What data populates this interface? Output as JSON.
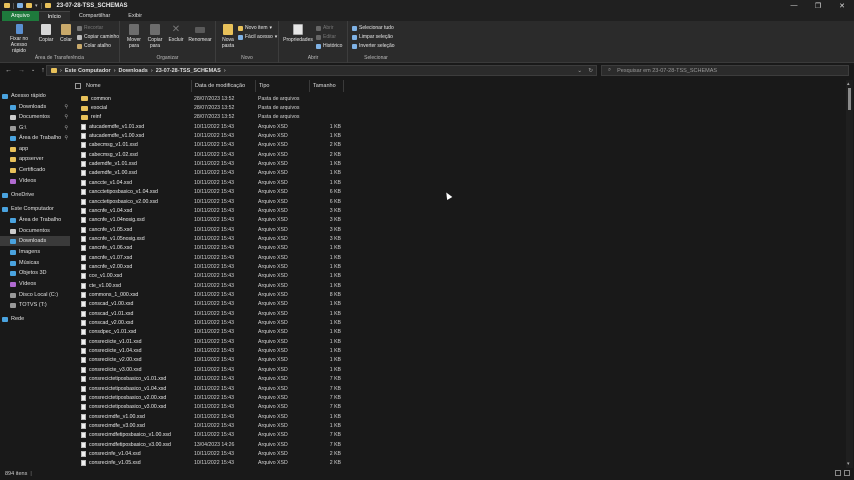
{
  "window": {
    "title": "23-07-28-TSS_SCHEMAS",
    "controls": [
      "—",
      "❐",
      "✕"
    ]
  },
  "tabs": [
    "Arquivo",
    "Início",
    "Compartilhar",
    "Exibir"
  ],
  "ribbon": {
    "groups": {
      "clipboard": "Área de Transferência",
      "organize": "Organizar",
      "new": "Novo",
      "open": "Abrir",
      "select": "Selecionar"
    },
    "buttons": {
      "pin": "Fixar no Acesso rápido",
      "copy": "Copiar",
      "paste": "Colar",
      "cut": "Recortar",
      "copy_path": "Copiar caminho",
      "paste_shortcut": "Colar atalho",
      "move_to": "Mover para",
      "copy_to": "Copiar para",
      "delete": "Excluir",
      "rename": "Renomear",
      "new_folder": "Nova pasta",
      "new_item": "Novo item",
      "easy_access": "Fácil acesso",
      "properties": "Propriedades",
      "open": "Abrir",
      "edit": "Editar",
      "history": "Histórico",
      "select_all": "Selecionar tudo",
      "select_none": "Limpar seleção",
      "invert": "Inverter seleção"
    }
  },
  "address": {
    "crumbs": [
      "Este Computador",
      "Downloads",
      "23-07-28-TSS_SCHEMAS"
    ],
    "search_placeholder": "Pesquisar em 23-07-28-TSS_SCHEMAS"
  },
  "nav_pane": {
    "items": [
      {
        "label": "Acesso rápido",
        "icon": "star-icon",
        "color": "#4aa3df"
      },
      {
        "label": "Downloads",
        "icon": "download-icon",
        "color": "#4aa3df",
        "pinned": true
      },
      {
        "label": "Documentos",
        "icon": "document-icon",
        "color": "#cccccc",
        "pinned": true
      },
      {
        "label": "G:\\",
        "icon": "drive-icon",
        "color": "#9a9a9a",
        "pinned": true
      },
      {
        "label": "Área de Trabalho",
        "icon": "desktop-icon",
        "color": "#4aa3df",
        "pinned": true
      },
      {
        "label": "app",
        "icon": "folder-icon",
        "color": "#e8c15a"
      },
      {
        "label": "appserver",
        "icon": "folder-icon",
        "color": "#e8c15a"
      },
      {
        "label": "Certificado",
        "icon": "folder-icon",
        "color": "#e8c15a"
      },
      {
        "label": "Vídeos",
        "icon": "video-icon",
        "color": "#b06ad0"
      },
      {
        "label": "OneDrive",
        "icon": "cloud-icon",
        "color": "#4aa3df"
      },
      {
        "label": "Este Computador",
        "icon": "computer-icon",
        "color": "#4aa3df"
      },
      {
        "label": "Área de Trabalho",
        "icon": "desktop-icon",
        "color": "#4aa3df"
      },
      {
        "label": "Documentos",
        "icon": "document-icon",
        "color": "#cccccc"
      },
      {
        "label": "Downloads",
        "icon": "download-icon",
        "color": "#4aa3df",
        "selected": true
      },
      {
        "label": "Imagens",
        "icon": "image-icon",
        "color": "#4aa3df"
      },
      {
        "label": "Músicas",
        "icon": "music-icon",
        "color": "#4aa3df"
      },
      {
        "label": "Objetos 3D",
        "icon": "cube-icon",
        "color": "#4aa3df"
      },
      {
        "label": "Vídeos",
        "icon": "video-icon",
        "color": "#b06ad0"
      },
      {
        "label": "Disco Local (C:)",
        "icon": "drive-icon",
        "color": "#9a9a9a"
      },
      {
        "label": "TOTVS (T:)",
        "icon": "network-drive-icon",
        "color": "#9a9a9a"
      },
      {
        "label": "Rede",
        "icon": "network-icon",
        "color": "#4aa3df"
      }
    ]
  },
  "columns": [
    "Nome",
    "Data de modificação",
    "Tipo",
    "Tamanho"
  ],
  "files": [
    {
      "name": "common",
      "date": "28/07/2023 13:52",
      "type": "Pasta de arquivos",
      "size": "",
      "folder": true
    },
    {
      "name": "esocial",
      "date": "28/07/2023 13:52",
      "type": "Pasta de arquivos",
      "size": "",
      "folder": true
    },
    {
      "name": "reinf",
      "date": "28/07/2023 13:52",
      "type": "Pasta de arquivos",
      "size": "",
      "folder": true
    },
    {
      "name": "atucademdfe_v1.01.xsd",
      "date": "10/11/2022 15:43",
      "type": "Arquivo XSD",
      "size": "1 KB"
    },
    {
      "name": "atucademdfe_v1.00.xsd",
      "date": "10/11/2022 15:43",
      "type": "Arquivo XSD",
      "size": "1 KB"
    },
    {
      "name": "cabecmsg_v1.01.xsd",
      "date": "10/11/2022 15:43",
      "type": "Arquivo XSD",
      "size": "2 KB"
    },
    {
      "name": "cabecmsg_v1.02.xsd",
      "date": "10/11/2022 15:43",
      "type": "Arquivo XSD",
      "size": "2 KB"
    },
    {
      "name": "cademdfe_v1.01.xsd",
      "date": "10/11/2022 15:43",
      "type": "Arquivo XSD",
      "size": "1 KB"
    },
    {
      "name": "cademdfe_v1.00.xsd",
      "date": "10/11/2022 15:43",
      "type": "Arquivo XSD",
      "size": "1 KB"
    },
    {
      "name": "canccte_v1.04.xsd",
      "date": "10/11/2022 15:43",
      "type": "Arquivo XSD",
      "size": "1 KB"
    },
    {
      "name": "cancctetiposbasico_v1.04.xsd",
      "date": "10/11/2022 15:43",
      "type": "Arquivo XSD",
      "size": "6 KB"
    },
    {
      "name": "cancctetiposbasico_v2.00.xsd",
      "date": "10/11/2022 15:43",
      "type": "Arquivo XSD",
      "size": "6 KB"
    },
    {
      "name": "cancnfe_v1.04.xsd",
      "date": "10/11/2022 15:43",
      "type": "Arquivo XSD",
      "size": "3 KB"
    },
    {
      "name": "cancnfe_v1.04nosig.xsd",
      "date": "10/11/2022 15:43",
      "type": "Arquivo XSD",
      "size": "3 KB"
    },
    {
      "name": "cancnfe_v1.05.xsd",
      "date": "10/11/2022 15:43",
      "type": "Arquivo XSD",
      "size": "3 KB"
    },
    {
      "name": "cancnfe_v1.05nosig.xsd",
      "date": "10/11/2022 15:43",
      "type": "Arquivo XSD",
      "size": "3 KB"
    },
    {
      "name": "cancnfe_v1.06.xsd",
      "date": "10/11/2022 15:43",
      "type": "Arquivo XSD",
      "size": "1 KB"
    },
    {
      "name": "cancnfe_v1.07.xsd",
      "date": "10/11/2022 15:43",
      "type": "Arquivo XSD",
      "size": "1 KB"
    },
    {
      "name": "cancnfe_v2.00.xsd",
      "date": "10/11/2022 15:43",
      "type": "Arquivo XSD",
      "size": "1 KB"
    },
    {
      "name": "cce_v1.00.xsd",
      "date": "10/11/2022 15:43",
      "type": "Arquivo XSD",
      "size": "1 KB"
    },
    {
      "name": "cte_v1.00.xsd",
      "date": "10/11/2022 15:43",
      "type": "Arquivo XSD",
      "size": "1 KB"
    },
    {
      "name": "commons_1_000.xsd",
      "date": "10/11/2022 15:43",
      "type": "Arquivo XSD",
      "size": "8 KB"
    },
    {
      "name": "conscad_v1.00.xsd",
      "date": "10/11/2022 15:43",
      "type": "Arquivo XSD",
      "size": "1 KB"
    },
    {
      "name": "conscad_v1.01.xsd",
      "date": "10/11/2022 15:43",
      "type": "Arquivo XSD",
      "size": "1 KB"
    },
    {
      "name": "conscad_v2.00.xsd",
      "date": "10/11/2022 15:43",
      "type": "Arquivo XSD",
      "size": "1 KB"
    },
    {
      "name": "consdpec_v1.01.xsd",
      "date": "10/11/2022 15:43",
      "type": "Arquivo XSD",
      "size": "1 KB"
    },
    {
      "name": "consreciicte_v1.01.xsd",
      "date": "10/11/2022 15:43",
      "type": "Arquivo XSD",
      "size": "1 KB"
    },
    {
      "name": "consreciicte_v1.04.xsd",
      "date": "10/11/2022 15:43",
      "type": "Arquivo XSD",
      "size": "1 KB"
    },
    {
      "name": "consreciicte_v2.00.xsd",
      "date": "10/11/2022 15:43",
      "type": "Arquivo XSD",
      "size": "1 KB"
    },
    {
      "name": "consreciicte_v3.00.xsd",
      "date": "10/11/2022 15:43",
      "type": "Arquivo XSD",
      "size": "1 KB"
    },
    {
      "name": "consrecictetiposbasico_v1.01.xsd",
      "date": "10/11/2022 15:43",
      "type": "Arquivo XSD",
      "size": "7 KB"
    },
    {
      "name": "consrecictetiposbasico_v1.04.xsd",
      "date": "10/11/2022 15:43",
      "type": "Arquivo XSD",
      "size": "7 KB"
    },
    {
      "name": "consrecictetiposbasico_v2.00.xsd",
      "date": "10/11/2022 15:43",
      "type": "Arquivo XSD",
      "size": "7 KB"
    },
    {
      "name": "consrecictetiposbasico_v3.00.xsd",
      "date": "10/11/2022 15:43",
      "type": "Arquivo XSD",
      "size": "7 KB"
    },
    {
      "name": "consrecimdfe_v1.00.xsd",
      "date": "10/11/2022 15:43",
      "type": "Arquivo XSD",
      "size": "1 KB"
    },
    {
      "name": "consrecimdfe_v3.00.xsd",
      "date": "10/11/2022 15:43",
      "type": "Arquivo XSD",
      "size": "1 KB"
    },
    {
      "name": "consrecimdfetiposbasico_v1.00.xsd",
      "date": "10/11/2022 15:43",
      "type": "Arquivo XSD",
      "size": "7 KB"
    },
    {
      "name": "consrecimdfetiposbasico_v3.00.xsd",
      "date": "13/04/2023 14:26",
      "type": "Arquivo XSD",
      "size": "7 KB"
    },
    {
      "name": "consrecinfe_v1.04.xsd",
      "date": "10/11/2022 15:43",
      "type": "Arquivo XSD",
      "size": "2 KB"
    },
    {
      "name": "consrecinfe_v1.05.xsd",
      "date": "10/11/2022 15:43",
      "type": "Arquivo XSD",
      "size": "2 KB"
    }
  ],
  "status": {
    "count": "894 itens"
  }
}
